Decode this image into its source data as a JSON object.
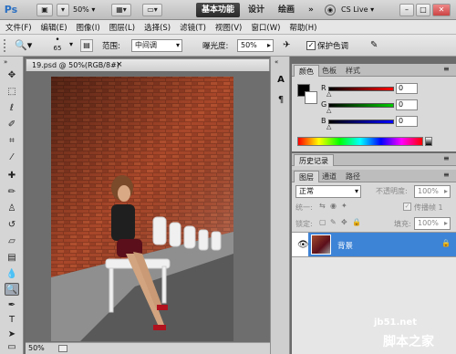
{
  "appbar": {
    "logo": "Ps",
    "zoom": "50%",
    "workspace_active": "基本功能",
    "workspace_tabs": [
      "设计",
      "绘画"
    ],
    "more": "»",
    "cs_live": "CS Live",
    "win_min": "–",
    "win_max": "□",
    "win_close": "✕"
  },
  "menubar": {
    "items": [
      "文件(F)",
      "编辑(E)",
      "图像(I)",
      "图层(L)",
      "选择(S)",
      "滤镜(T)",
      "视图(V)",
      "窗口(W)",
      "帮助(H)"
    ]
  },
  "options": {
    "brush_size": "65",
    "range_label": "范围:",
    "range_value": "中间调",
    "exposure_label": "曝光度:",
    "exposure_value": "50%",
    "protect_tones": "保护色调",
    "protect_checked": true
  },
  "document": {
    "tab_title": "19.psd @ 50%(RGB/8#)",
    "close_glyph": "×",
    "zoom": "50%"
  },
  "color_panel": {
    "tabs": [
      "颜色",
      "色板",
      "样式"
    ],
    "channels": [
      {
        "label": "R",
        "value": "0",
        "color": "#d00000"
      },
      {
        "label": "G",
        "value": "0",
        "color": "#00a000"
      },
      {
        "label": "B",
        "value": "0",
        "color": "#0000c8"
      }
    ]
  },
  "history_panel": {
    "tabs": [
      "历史记录"
    ]
  },
  "layers_panel": {
    "tabs": [
      "图层",
      "通道",
      "路径"
    ],
    "blend_mode": "正常",
    "opacity_label": "不透明度:",
    "opacity_value": "100%",
    "unify_label": "统一:",
    "propagate_label": "传播帧 1",
    "lock_label": "锁定:",
    "fill_label": "填充:",
    "fill_value": "100%",
    "layers": [
      {
        "name": "背景",
        "selected": true,
        "visible": true,
        "locked": true
      }
    ]
  },
  "watermark": {
    "site": "jb51.net",
    "name": "脚本之家"
  },
  "colors": {
    "accent": "#3d83d6",
    "selected_layer": "#3d83d6"
  }
}
